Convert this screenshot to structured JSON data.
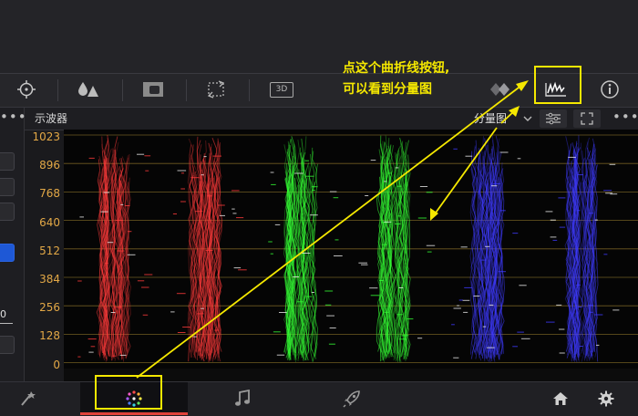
{
  "panel": {
    "title": "示波器",
    "mode_label": "分量图",
    "left_value": "0"
  },
  "scope": {
    "mode": "parade",
    "y_ticks": [
      "1023",
      "896",
      "768",
      "640",
      "512",
      "384",
      "256",
      "128",
      "0"
    ],
    "channels": [
      {
        "color": "#ff3b3b"
      },
      {
        "color": "#ff3b3b"
      },
      {
        "color": "#35ff35"
      },
      {
        "color": "#35ff35"
      },
      {
        "color": "#3f3bff"
      },
      {
        "color": "#3f3bff"
      }
    ],
    "graticule_color": "#c9a43a"
  },
  "toolbar": {
    "icons": [
      "target-icon",
      "drops-icon",
      "window-icon",
      "rotate-icon",
      "3d-icon",
      "diamond-icon",
      "waveform-curve-icon",
      "info-icon"
    ],
    "label_3d": "3D"
  },
  "annotation": {
    "line1": "点这个曲折线按钮,",
    "line2": "可以看到分量图",
    "color": "#f5e800"
  },
  "bottom_nav": {
    "pages": [
      "edit-icon",
      "color-icon",
      "audio-icon",
      "deliver-icon"
    ],
    "right": [
      "home-icon",
      "gear-icon"
    ]
  }
}
